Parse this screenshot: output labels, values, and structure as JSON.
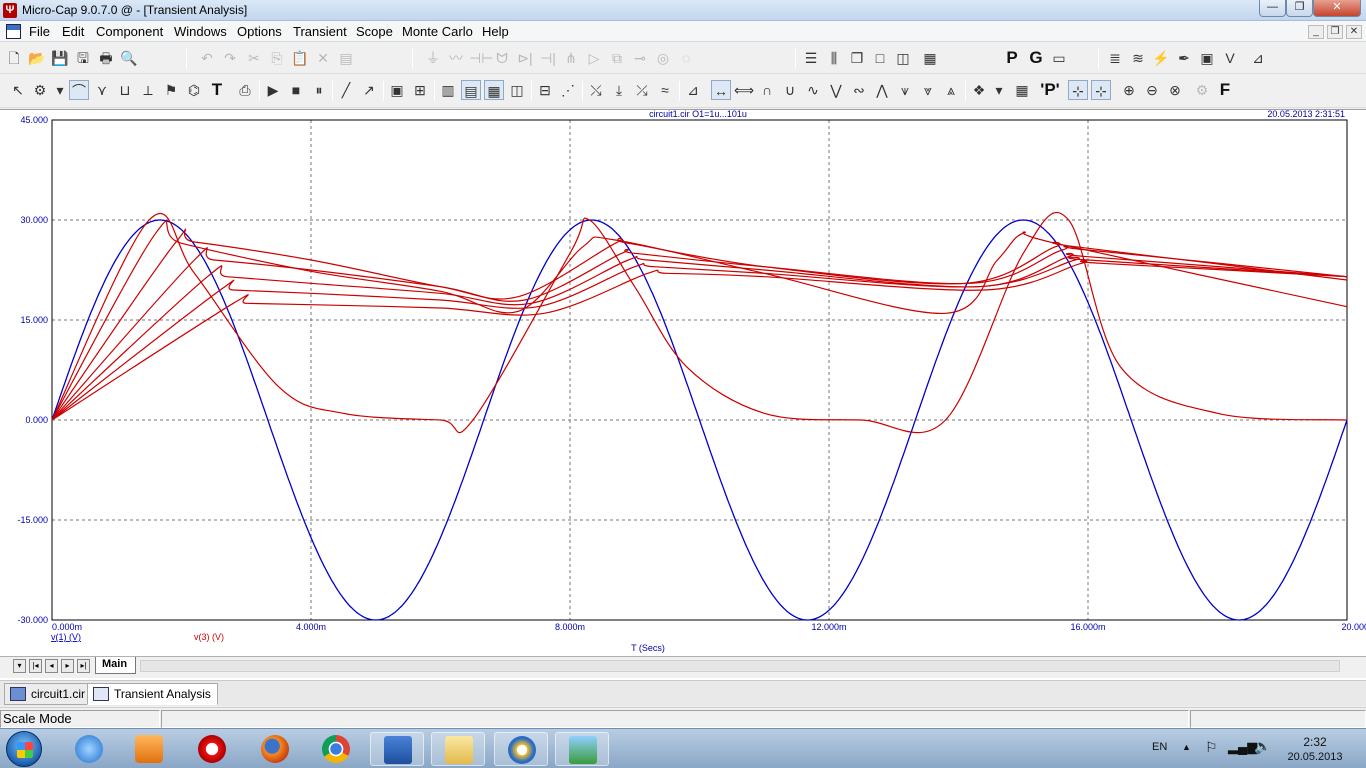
{
  "window": {
    "title": "Micro-Cap 9.0.7.0 @ - [Transient Analysis]",
    "app_icon": "Ψ"
  },
  "window_controls": {
    "minimize": "—",
    "maximize": "❐",
    "close": "✕"
  },
  "menu": {
    "items": [
      "File",
      "Edit",
      "Component",
      "Windows",
      "Options",
      "Transient",
      "Scope",
      "Monte Carlo",
      "Help"
    ],
    "mdi": {
      "minimize": "_",
      "restore": "❐",
      "close": "✕"
    }
  },
  "toolbar1": {
    "p_label": "P",
    "g_label": "G"
  },
  "toolbar2": {
    "text_tool": "T",
    "p_marker": "'P'",
    "f_label": "F"
  },
  "plot": {
    "header_left": "circuit1.cir O1=1u...101u",
    "header_right": "20.05.2013 2:31:51",
    "x_axis_label": "T (Secs)",
    "legend_v1": "v(1) (V)",
    "legend_v3": "v(3) (V)"
  },
  "chart_data": {
    "type": "line",
    "xlabel": "T (Secs)",
    "xlim": [
      0,
      0.02
    ],
    "ylim": [
      -30,
      45
    ],
    "x_ticks": [
      "0.000m",
      "4.000m",
      "8.000m",
      "12.000m",
      "16.000m",
      "20.000m"
    ],
    "y_ticks": [
      "45.000",
      "30.000",
      "15.000",
      "0.000",
      "-15.000",
      "-30.000"
    ],
    "grid": true,
    "series": [
      {
        "name": "v(1) (V)",
        "color": "#0000cc",
        "description_values": {
          "amplitude": 30,
          "frequency_hz": 150,
          "offset": 0
        }
      },
      {
        "name": "v(3) (V)",
        "color": "#cc0000",
        "runs": [
          {
            "x": [
              0,
              0.0015,
              0.0022,
              0.0035,
              0.0045,
              0.006,
              0.0065,
              0.008,
              0.0083,
              0.009,
              0.0098,
              0.011,
              0.0125,
              0.0138,
              0.015,
              0.0157,
              0.0165,
              0.018,
              0.02
            ],
            "y": [
              0,
              30,
              22,
              5,
              1,
              0,
              0,
              25,
              30,
              20,
              8,
              1,
              0,
              0,
              25,
              30,
              8,
              1,
              0
            ]
          },
          {
            "x": [
              0,
              0.0016,
              0.002,
              0.004,
              0.006,
              0.0072,
              0.0082,
              0.0087,
              0.011,
              0.0138,
              0.0146,
              0.015,
              0.0155,
              0.02
            ],
            "y": [
              0,
              28,
              26.5,
              22.3,
              19.3,
              16.3,
              26,
              27,
              22,
              16,
              24,
              28,
              26.5,
              17
            ]
          },
          {
            "x": [
              0,
              0.0019,
              0.0022,
              0.004,
              0.006,
              0.0072,
              0.0087,
              0.0089,
              0.011,
              0.0141,
              0.0155,
              0.0158,
              0.02
            ],
            "y": [
              0,
              26.5,
              26.7,
              24,
              20,
              18.5,
              26.5,
              26.5,
              23,
              20.5,
              26,
              26,
              21
            ]
          },
          {
            "x": [
              0,
              0.0022,
              0.0025,
              0.004,
              0.006,
              0.0073,
              0.0088,
              0.009,
              0.011,
              0.0142,
              0.0156,
              0.016,
              0.02
            ],
            "y": [
              0,
              24,
              24,
              22.5,
              20,
              18,
              25,
              25,
              23,
              20.5,
              25.5,
              25.5,
              21.5
            ]
          },
          {
            "x": [
              0,
              0.0024,
              0.0027,
              0.004,
              0.006,
              0.0074,
              0.0089,
              0.0092,
              0.011,
              0.0143,
              0.0157,
              0.016,
              0.02
            ],
            "y": [
              0,
              21.5,
              21.5,
              20.5,
              19,
              17.5,
              24,
              24,
              22.5,
              20,
              24.5,
              24.5,
              21.5
            ]
          },
          {
            "x": [
              0,
              0.0026,
              0.0028,
              0.004,
              0.006,
              0.0075,
              0.009,
              0.0093,
              0.011,
              0.0143,
              0.0158,
              0.016,
              0.02
            ],
            "y": [
              0,
              19.5,
              19.5,
              19,
              18,
              17,
              23,
              23,
              22,
              20,
              24,
              24,
              21.5
            ]
          },
          {
            "x": [
              0,
              0.0028,
              0.003,
              0.004,
              0.006,
              0.0076,
              0.0092,
              0.0095,
              0.011,
              0.0144,
              0.0159,
              0.0162,
              0.02
            ],
            "y": [
              0,
              17.5,
              17.5,
              17.3,
              16.8,
              16,
              22,
              22,
              21.5,
              19.5,
              23.5,
              23.5,
              21.5
            ]
          }
        ]
      }
    ]
  },
  "tabs": {
    "main_tab": "Main",
    "nav": [
      "▾",
      "|◂",
      "◂",
      "▸",
      "▸|"
    ]
  },
  "doc_tabs": [
    "circuit1.cir",
    "Transient Analysis"
  ],
  "status": {
    "mode": "Scale Mode"
  },
  "taskbar": {
    "lang": "EN",
    "time": "2:32",
    "date": "20.05.2013"
  }
}
